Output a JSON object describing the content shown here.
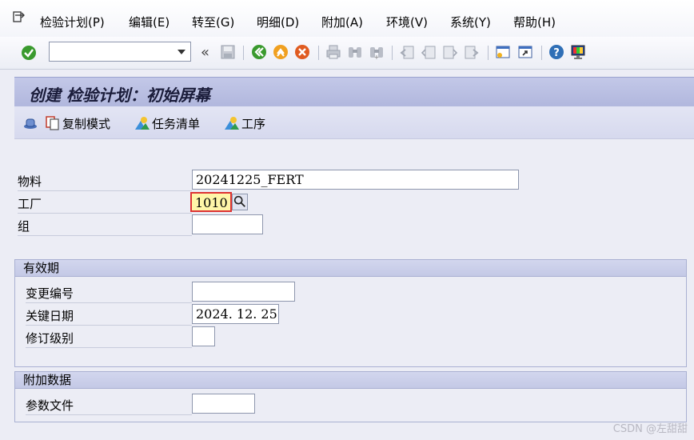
{
  "menu": {
    "items": [
      "检验计划(P)",
      "编辑(E)",
      "转至(G)",
      "明细(D)",
      "附加(A)",
      "环境(V)",
      "系统(Y)",
      "帮助(H)"
    ]
  },
  "toolbar": {
    "command_value": "",
    "back_glyph": "«",
    "icons": [
      "enter-icon",
      "save-icon",
      "back-icon",
      "exit-icon",
      "cancel-icon",
      "print-icon",
      "find-icon",
      "find-next-icon",
      "first-page-icon",
      "previous-page-icon",
      "next-page-icon",
      "last-page-icon",
      "create-session-icon",
      "shortcut-icon",
      "help-icon",
      "customize-layout-icon"
    ]
  },
  "title": "创建 检验计划：初始屏幕",
  "app_toolbar": {
    "copy_mode": "复制模式",
    "task_list": "任务清单",
    "operations": "工序"
  },
  "form": {
    "material_label": "物料",
    "material_value": "20241225_FERT",
    "plant_label": "工厂",
    "plant_value": "1010",
    "group_label": "组",
    "group_value": ""
  },
  "validity": {
    "title": "有效期",
    "change_number_label": "变更编号",
    "change_number_value": "",
    "key_date_label": "关键日期",
    "key_date_value": "2024. 12. 25",
    "revision_level_label": "修订级别",
    "revision_level_value": ""
  },
  "additional": {
    "title": "附加数据",
    "profile_label": "参数文件",
    "profile_value": ""
  },
  "watermark": "CSDN @左甜甜"
}
